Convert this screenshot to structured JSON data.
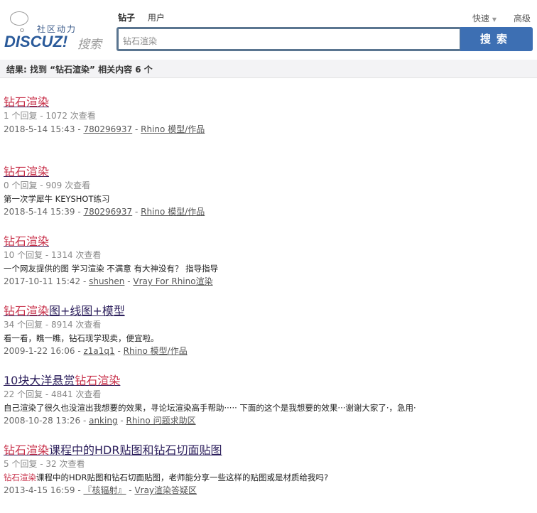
{
  "logo": {
    "slogan": "社区动力",
    "brand": "DISCUZ!",
    "suffix": "搜索"
  },
  "tabs": [
    {
      "label": "钻子"
    },
    {
      "label": "用户"
    }
  ],
  "search": {
    "value": "钻石渲染",
    "button": "搜索"
  },
  "quick": "快速",
  "advanced": "高级",
  "summary": "结果: 找到 “钻石渲染” 相关内容 6 个",
  "results": [
    {
      "title": [
        {
          "t": "钻石渲染",
          "hl": true
        }
      ],
      "stats": "1 个回复 - 1072 次查看",
      "snippet": [],
      "date": "2018-5-14 15:43",
      "author": "780296937",
      "forum": "Rhino 模型/作品"
    },
    {
      "title": [
        {
          "t": "钻石渲染",
          "hl": true
        }
      ],
      "stats": "0 个回复 - 909 次查看",
      "snippet": [
        {
          "t": "第一次学犀牛 KEYSHOT练习"
        }
      ],
      "date": "2018-5-14 15:39",
      "author": "780296937",
      "forum": "Rhino 模型/作品"
    },
    {
      "title": [
        {
          "t": "钻石渲染",
          "hl": true
        }
      ],
      "stats": "10 个回复 - 1314 次查看",
      "snippet": [
        {
          "t": "一个网友提供的图 学习渲染 不满意 有大神没有？ 指导指导"
        }
      ],
      "date": "2017-10-11 15:42",
      "author": "shushen",
      "forum": "Vray For Rhino渲染"
    },
    {
      "title": [
        {
          "t": "钻石渲染",
          "hl": true
        },
        {
          "t": "图+线图+模型"
        }
      ],
      "stats": "34 个回复 - 8914 次查看",
      "snippet": [
        {
          "t": "看一看，瞧一瞧，钻石现学现卖，便宜啦。"
        }
      ],
      "date": "2009-1-22 16:06",
      "author": "z1a1q1",
      "forum": "Rhino 模型/作品"
    },
    {
      "title": [
        {
          "t": "10块大洋悬赏"
        },
        {
          "t": "钻石渲染",
          "hl": true
        }
      ],
      "stats": "22 个回复 - 4841 次查看",
      "snippet": [
        {
          "t": "自己渲染了很久也没渲出我想要的效果，寻论坛渲染高手帮助····· 下面的这个是我想要的效果···谢谢大家了·，急用·"
        }
      ],
      "date": "2008-10-28 13:26",
      "author": "anking",
      "forum": "Rhino 问题求助区"
    },
    {
      "title": [
        {
          "t": "钻石渲染",
          "hl": true
        },
        {
          "t": "课程中的HDR贴图和钻石切面贴图"
        }
      ],
      "stats": "5 个回复 - 32 次查看",
      "snippet": [
        {
          "t": "钻石渲染",
          "hl": true
        },
        {
          "t": "课程中的HDR贴图和钻石切面贴图，老师能分享一些这样的贴图或是材质给我吗?"
        }
      ],
      "date": "2013-4-15 16:59",
      "author": "『核辐射』",
      "forum": "Vray渲染答疑区"
    }
  ]
}
